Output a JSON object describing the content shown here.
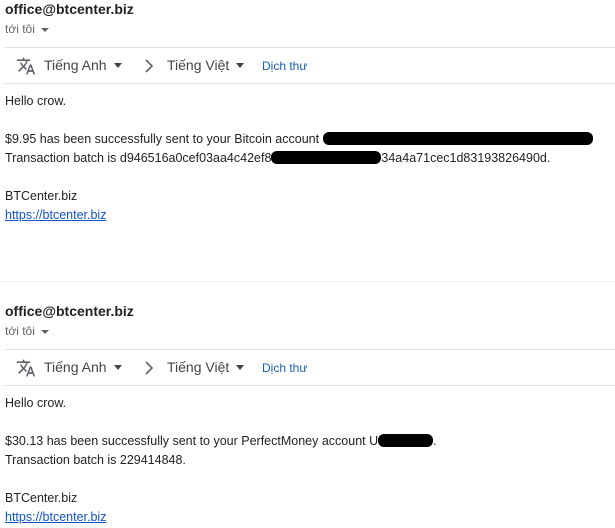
{
  "emails": [
    {
      "sender": "office@btcenter.biz",
      "recipient": "tới tôi",
      "translate": {
        "source_lang": "Tiếng Anh",
        "target_lang": "Tiếng Việt",
        "action": "Dịch thư"
      },
      "greeting": "Hello crow.",
      "line1_prefix": "$9.95 has been successfully sent to your Bitcoin account ",
      "line2_prefix": "Transaction batch is d946516a0cef03aa4c42ef8",
      "line2_suffix": "34a4a71cec1d83193826490d.",
      "signature": "BTCenter.biz",
      "link": "https://btcenter.biz"
    },
    {
      "sender": "office@btcenter.biz",
      "recipient": "tới tôi",
      "translate": {
        "source_lang": "Tiếng Anh",
        "target_lang": "Tiếng Việt",
        "action": "Dịch thư"
      },
      "greeting": "Hello crow.",
      "line1_prefix": "$30.13 has been successfully sent to your PerfectMoney account U",
      "line1_suffix": ".",
      "line2": "Transaction batch is 229414848.",
      "signature": "BTCenter.biz",
      "link": "https://btcenter.biz"
    }
  ],
  "colors": {
    "link": "#1155cc",
    "redaction": "#000000",
    "text": "#222222"
  },
  "icons": {
    "translate": "translate-icon",
    "arrow": "chevron-right-icon",
    "dropdown": "caret-down-icon"
  }
}
